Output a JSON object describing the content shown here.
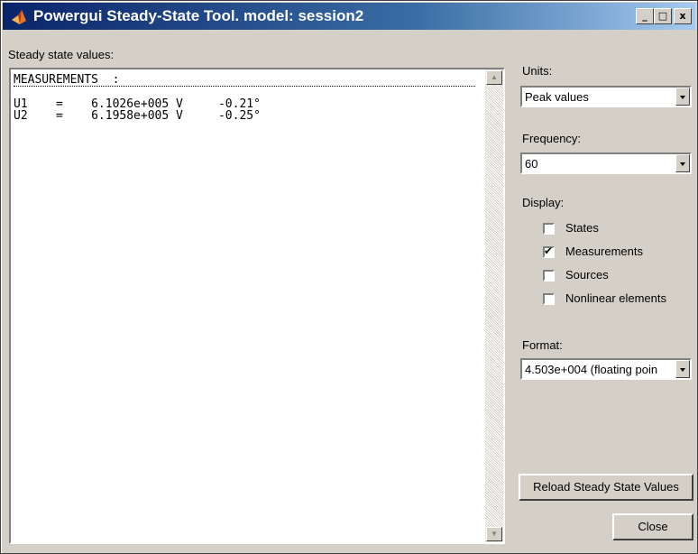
{
  "window": {
    "title": "Powergui Steady-State Tool. model: session2",
    "icon": "matlab-icon",
    "controls": {
      "minimize": "_",
      "maximize": "□",
      "close": "x"
    }
  },
  "main": {
    "values_label": "Steady state values:",
    "heading": "MEASUREMENTS  :",
    "rows": [
      "U1    =    6.1026e+005 V     -0.21°",
      "U2    =    6.1958e+005 V     -0.25°"
    ]
  },
  "units": {
    "label": "Units:",
    "value": "Peak values"
  },
  "frequency": {
    "label": "Frequency:",
    "value": "60"
  },
  "display": {
    "label": "Display:",
    "options": [
      {
        "label": "States",
        "checked": false
      },
      {
        "label": "Measurements",
        "checked": true
      },
      {
        "label": "Sources",
        "checked": false
      },
      {
        "label": "Nonlinear elements",
        "checked": false
      }
    ]
  },
  "format": {
    "label": "Format:",
    "value": "4.503e+004 (floating poin"
  },
  "buttons": {
    "reload": "Reload Steady State Values",
    "close": "Close"
  },
  "colors": {
    "titlebar_start": "#0a246a",
    "titlebar_end": "#a6caf0",
    "face": "#d4d0c8"
  }
}
